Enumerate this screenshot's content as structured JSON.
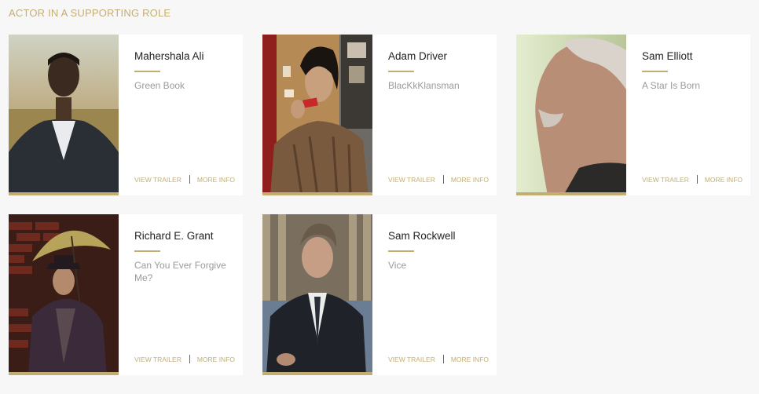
{
  "section": {
    "title": "ACTOR IN A SUPPORTING ROLE"
  },
  "colors": {
    "accent": "#c3ae72",
    "background": "#f7f7f7",
    "card": "#ffffff"
  },
  "nominees": [
    {
      "name": "Mahershala Ali",
      "film": "Green Book",
      "trailer_label": "VIEW TRAILER",
      "info_label": "MORE INFO"
    },
    {
      "name": "Adam Driver",
      "film": "BlacKkKlansman",
      "trailer_label": "VIEW TRAILER",
      "info_label": "MORE INFO"
    },
    {
      "name": "Sam Elliott",
      "film": "A Star Is Born",
      "trailer_label": "VIEW TRAILER",
      "info_label": "MORE INFO"
    },
    {
      "name": "Richard E. Grant",
      "film": "Can You Ever Forgive Me?",
      "trailer_label": "VIEW TRAILER",
      "info_label": "MORE INFO"
    },
    {
      "name": "Sam Rockwell",
      "film": "Vice",
      "trailer_label": "VIEW TRAILER",
      "info_label": "MORE INFO"
    }
  ]
}
